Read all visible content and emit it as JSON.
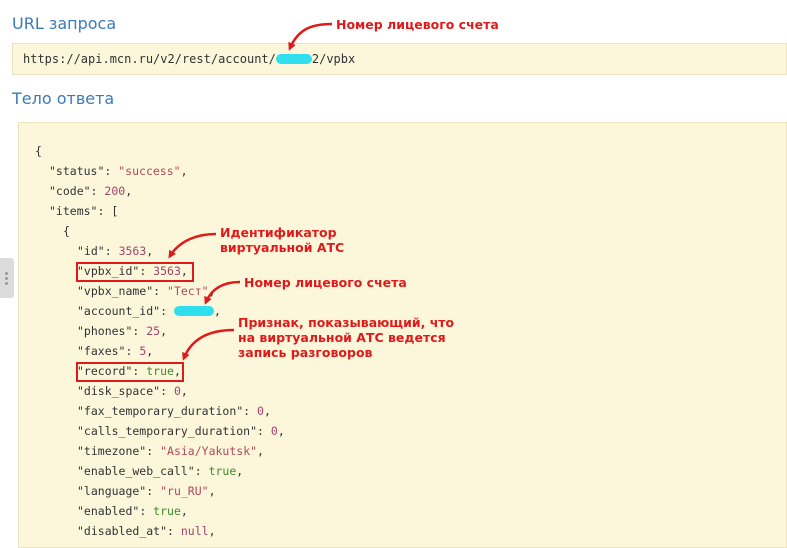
{
  "sections": {
    "url_title": "URL запроса",
    "response_title": "Тело ответа"
  },
  "url": {
    "prefix": "https://api.mcn.ru/v2/rest/account/",
    "suffix": "2/vpbx"
  },
  "annotations": {
    "account_url": "Номер лицевого счета",
    "vpbx_id_line1": "Идентификатор",
    "vpbx_id_line2": "виртуальной АТС",
    "account_id": "Номер лицевого счета",
    "record_line1": "Признак, показывающий, что",
    "record_line2": "на виртуальной АТС ведется",
    "record_line3": "запись разговоров"
  },
  "json_lines": [
    {
      "indent": 0,
      "text": "{"
    },
    {
      "indent": 1,
      "key": "\"status\"",
      "val": "\"success\"",
      "type": "s",
      "tail": ","
    },
    {
      "indent": 1,
      "key": "\"code\"",
      "val": "200",
      "type": "n",
      "tail": ","
    },
    {
      "indent": 1,
      "key": "\"items\"",
      "val": "[",
      "type": "p",
      "tail": ""
    },
    {
      "indent": 2,
      "text": "{"
    },
    {
      "indent": 3,
      "key": "\"id\"",
      "val": "3563",
      "type": "n",
      "tail": ","
    },
    {
      "indent": 3,
      "key": "\"vpbx_id\"",
      "val": "3563",
      "type": "n",
      "tail": ","
    },
    {
      "indent": 3,
      "key": "\"vpbx_name\"",
      "val": "\"Тест\"",
      "type": "s",
      "tail": ","
    },
    {
      "indent": 3,
      "key": "\"account_id\"",
      "val": "",
      "type": "redacted",
      "tail": ","
    },
    {
      "indent": 3,
      "key": "\"phones\"",
      "val": "25",
      "type": "n",
      "tail": ","
    },
    {
      "indent": 3,
      "key": "\"faxes\"",
      "val": "5",
      "type": "n",
      "tail": ","
    },
    {
      "indent": 3,
      "key": "\"record\"",
      "val": "true",
      "type": "b",
      "tail": ","
    },
    {
      "indent": 3,
      "key": "\"disk_space\"",
      "val": "0",
      "type": "n",
      "tail": ","
    },
    {
      "indent": 3,
      "key": "\"fax_temporary_duration\"",
      "val": "0",
      "type": "n",
      "tail": ","
    },
    {
      "indent": 3,
      "key": "\"calls_temporary_duration\"",
      "val": "0",
      "type": "n",
      "tail": ","
    },
    {
      "indent": 3,
      "key": "\"timezone\"",
      "val": "\"Asia/Yakutsk\"",
      "type": "s",
      "tail": ","
    },
    {
      "indent": 3,
      "key": "\"enable_web_call\"",
      "val": "true",
      "type": "b",
      "tail": ","
    },
    {
      "indent": 3,
      "key": "\"language\"",
      "val": "\"ru_RU\"",
      "type": "s",
      "tail": ","
    },
    {
      "indent": 3,
      "key": "\"enabled\"",
      "val": "true",
      "type": "b",
      "tail": ","
    },
    {
      "indent": 3,
      "key": "\"disabled_at\"",
      "val": "null",
      "type": "n",
      "tail": ","
    }
  ],
  "colors": {
    "title": "#3b7ab8",
    "code_bg": "#fcf6db",
    "string": "#b5485a",
    "number": "#a0456a",
    "boolean": "#3f8a2c",
    "annotation": "#e01a1a",
    "redaction": "#2fdff0"
  }
}
